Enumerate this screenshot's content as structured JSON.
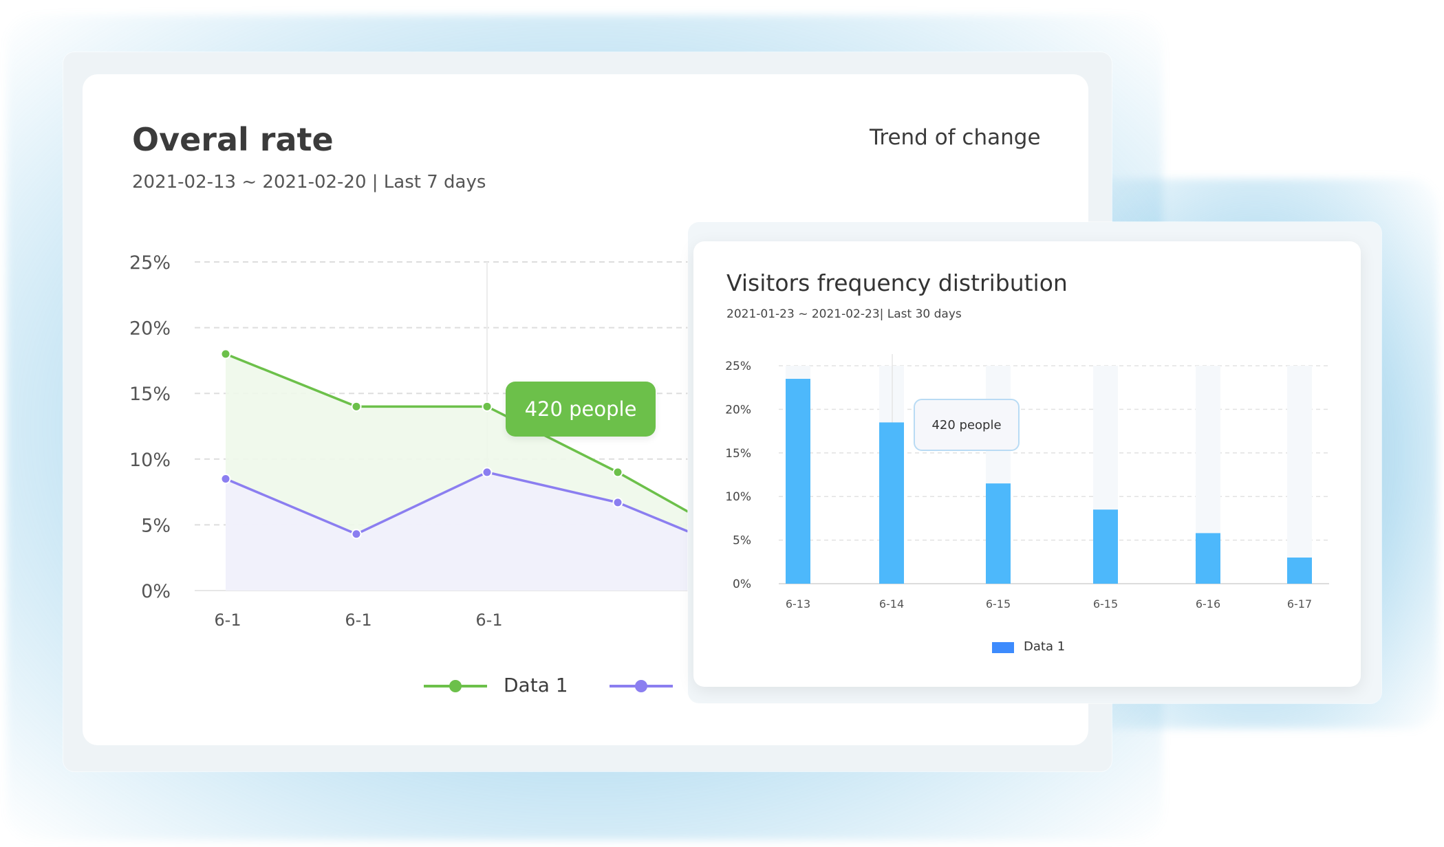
{
  "main_panel": {
    "title": "Overal rate",
    "subtitle": "2021-02-13 ~ 2021-02-20 | Last 7 days",
    "trend_link": "Trend of change",
    "tooltip": "420 people",
    "legend_1": "Data 1"
  },
  "side_panel": {
    "title": "Visitors frequency distribution",
    "subtitle": "2021-01-23 ~ 2021-02-23| Last 30 days",
    "tooltip": "420 people",
    "legend_1": "Data 1"
  },
  "colors": {
    "green": "#6cc04a",
    "purple": "#8b7ef0",
    "bar": "#4db8fb",
    "legend_bar": "#3d8bfd",
    "tooltip_green": "#6cc04a"
  },
  "chart_data": [
    {
      "type": "line",
      "x": [
        "6-1",
        "6-1",
        "6-1",
        "",
        ""
      ],
      "ylim": [
        0,
        25
      ],
      "yticks": [
        "0%",
        "5%",
        "10%",
        "15%",
        "20%",
        "25%"
      ],
      "series": [
        {
          "name": "Data 1",
          "values": [
            18,
            14,
            14,
            9,
            6
          ]
        },
        {
          "values": [
            8.5,
            4.3,
            9,
            6.7,
            4.5
          ]
        }
      ]
    },
    {
      "type": "bar",
      "categories": [
        "6-13",
        "6-14",
        "6-15",
        "6-15",
        "6-16",
        "6-17"
      ],
      "ylim": [
        0,
        25
      ],
      "yticks": [
        "0%",
        "5%",
        "10%",
        "15%",
        "20%",
        "25%"
      ],
      "series": [
        {
          "name": "Data 1",
          "values": [
            23.5,
            18.5,
            11.5,
            8.5,
            5.8,
            3
          ]
        }
      ]
    }
  ]
}
